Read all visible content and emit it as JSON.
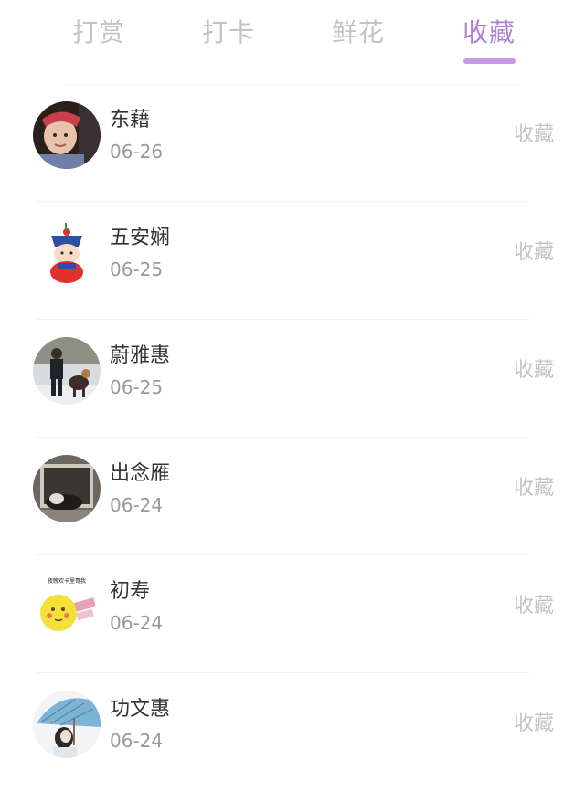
{
  "tabs": [
    {
      "label": "打赏"
    },
    {
      "label": "打卡"
    },
    {
      "label": "鲜花"
    },
    {
      "label": "收藏"
    }
  ],
  "active_tab": "收藏",
  "colors": {
    "accent": "#c99be6",
    "inactive": "#c4c4c4"
  },
  "items": [
    {
      "name": "东藉",
      "date": "06-26",
      "action": "收藏",
      "avatar_icon": "baby-photo-icon"
    },
    {
      "name": "五安娴",
      "date": "06-25",
      "action": "收藏",
      "avatar_icon": "cartoon-character-icon"
    },
    {
      "name": "蔚雅惠",
      "date": "06-25",
      "action": "收藏",
      "avatar_icon": "person-with-dog-photo-icon"
    },
    {
      "name": "出念雁",
      "date": "06-24",
      "action": "收藏",
      "avatar_icon": "sleeping-pet-photo-icon"
    },
    {
      "name": "初寿",
      "date": "06-24",
      "action": "收藏",
      "avatar_icon": "moon-face-sticker-icon",
      "avatar_caption": "夜晚欢卡里哥我"
    },
    {
      "name": "功文惠",
      "date": "06-24",
      "action": "收藏",
      "avatar_icon": "umbrella-girl-photo-icon"
    }
  ]
}
